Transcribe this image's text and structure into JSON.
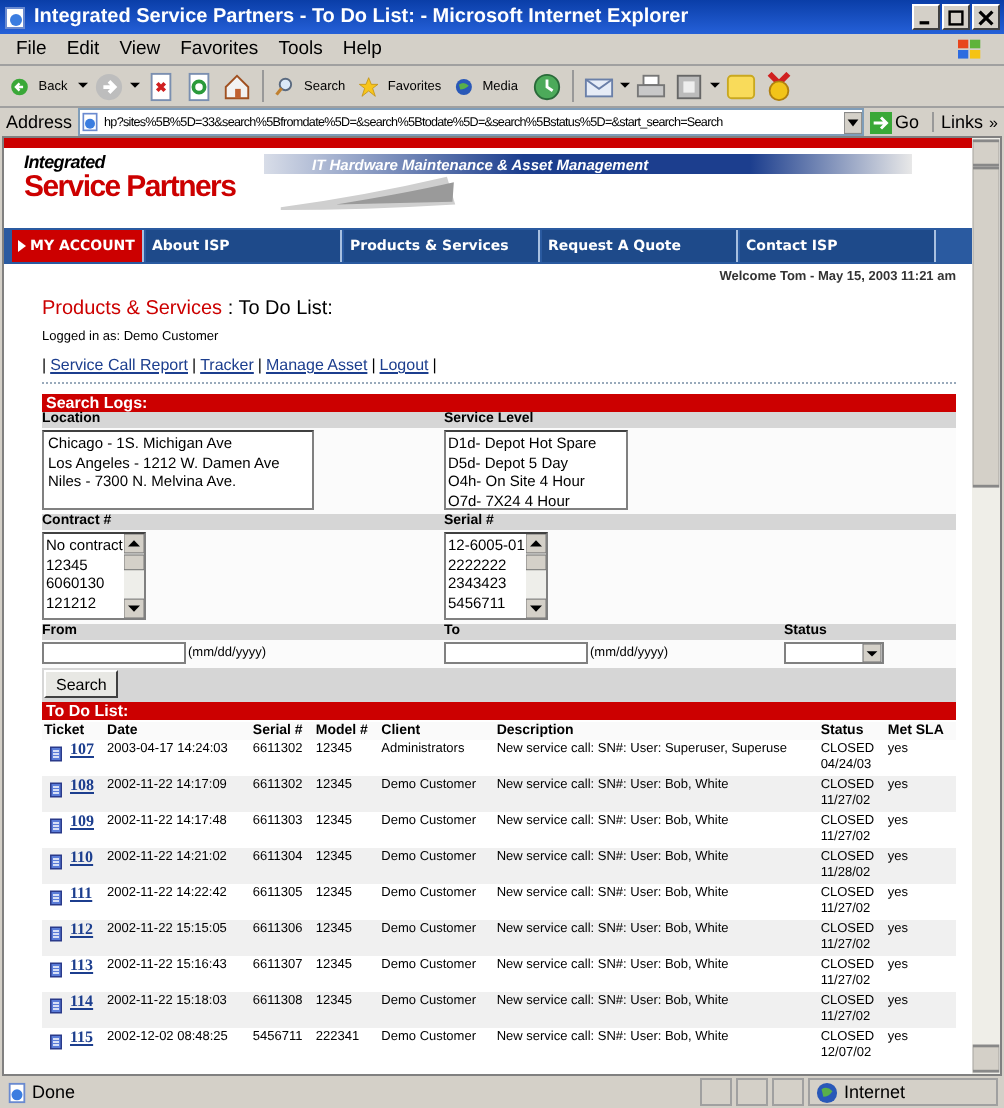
{
  "window": {
    "title": "Integrated Service Partners - To Do List: - Microsoft Internet Explorer"
  },
  "menu": [
    "File",
    "Edit",
    "View",
    "Favorites",
    "Tools",
    "Help"
  ],
  "toolbar": [
    {
      "kind": "back",
      "label": "Back"
    },
    {
      "kind": "forward"
    },
    {
      "kind": "stop"
    },
    {
      "kind": "refresh"
    },
    {
      "kind": "home"
    },
    {
      "kind": "search",
      "label": "Search"
    },
    {
      "kind": "favorites",
      "label": "Favorites"
    },
    {
      "kind": "media",
      "label": "Media"
    },
    {
      "kind": "history"
    },
    {
      "kind": "mail"
    },
    {
      "kind": "print"
    },
    {
      "kind": "edit"
    },
    {
      "kind": "notes"
    },
    {
      "kind": "messenger"
    }
  ],
  "address": {
    "label": "Address",
    "value": "hp?sites%5B%5D=33&search%5Bfromdate%5D=&search%5Btodate%5D=&search%5Bstatus%5D=&start_search=Search",
    "go": "Go",
    "links": "Links",
    "more": "»"
  },
  "banner": {
    "logo_top": "Integrated",
    "logo_bottom": "Service Partners",
    "tagline": "IT Hardware Maintenance & Asset Management"
  },
  "nav": [
    {
      "label": "MY ACCOUNT",
      "selected": true
    },
    {
      "label": "About ISP",
      "selected": false
    },
    {
      "label": "Products & Services",
      "selected": false
    },
    {
      "label": "Request A Quote",
      "selected": false
    },
    {
      "label": "Contact ISP",
      "selected": false
    }
  ],
  "welcome": "Welcome Tom - May 15, 2003 11:21 am",
  "heading": {
    "section": "Products & Services",
    "page": ": To Do List:"
  },
  "logged_in": "Logged in as: Demo Customer",
  "links": {
    "separator": "|",
    "items": [
      "Service Call Report",
      "Tracker",
      "Manage Asset",
      "Logout"
    ]
  },
  "search": {
    "title": "Search Logs:",
    "location": {
      "label": "Location",
      "options": [
        "Chicago - 1S. Michigan Ave",
        "Los Angeles - 1212 W. Damen Ave",
        "Niles - 7300 N. Melvina Ave."
      ]
    },
    "service_level": {
      "label": "Service Level",
      "options": [
        "D1d- Depot Hot Spare",
        "D5d- Depot 5 Day",
        "O4h- On Site 4 Hour",
        "O7d- 7X24 4 Hour"
      ]
    },
    "contract": {
      "label": "Contract #",
      "options": [
        "No contract",
        "12345",
        "6060130",
        "121212"
      ]
    },
    "serial": {
      "label": "Serial #",
      "options": [
        "12-6005-01",
        "2222222",
        "2343423",
        "5456711"
      ]
    },
    "from": {
      "label": "From",
      "hint": "(mm/dd/yyyy)"
    },
    "to": {
      "label": "To",
      "hint": "(mm/dd/yyyy)"
    },
    "status": {
      "label": "Status"
    },
    "button": "Search"
  },
  "todo": {
    "title": "To Do List:",
    "columns": [
      "Ticket",
      "Date",
      "Serial #",
      "Model #",
      "Client",
      "Description",
      "Status",
      "Met SLA"
    ],
    "rows": [
      {
        "ticket": "107",
        "date": "2003-04-17 14:24:03",
        "serial": "6611302",
        "model": "12345",
        "client": "Administrators",
        "description": "New service call: SN#: User: Superuser, Superuse",
        "status": "CLOSED",
        "status_date": "04/24/03",
        "met_sla": "yes"
      },
      {
        "ticket": "108",
        "date": "2002-11-22 14:17:09",
        "serial": "6611302",
        "model": "12345",
        "client": "Demo Customer",
        "description": "New service call: SN#: User: Bob, White",
        "status": "CLOSED",
        "status_date": "11/27/02",
        "met_sla": "yes"
      },
      {
        "ticket": "109",
        "date": "2002-11-22 14:17:48",
        "serial": "6611303",
        "model": "12345",
        "client": "Demo Customer",
        "description": "New service call: SN#: User: Bob, White",
        "status": "CLOSED",
        "status_date": "11/27/02",
        "met_sla": "yes"
      },
      {
        "ticket": "110",
        "date": "2002-11-22 14:21:02",
        "serial": "6611304",
        "model": "12345",
        "client": "Demo Customer",
        "description": "New service call: SN#: User: Bob, White",
        "status": "CLOSED",
        "status_date": "11/28/02",
        "met_sla": "yes"
      },
      {
        "ticket": "111",
        "date": "2002-11-22 14:22:42",
        "serial": "6611305",
        "model": "12345",
        "client": "Demo Customer",
        "description": "New service call: SN#: User: Bob, White",
        "status": "CLOSED",
        "status_date": "11/27/02",
        "met_sla": "yes"
      },
      {
        "ticket": "112",
        "date": "2002-11-22 15:15:05",
        "serial": "6611306",
        "model": "12345",
        "client": "Demo Customer",
        "description": "New service call: SN#: User: Bob, White",
        "status": "CLOSED",
        "status_date": "11/27/02",
        "met_sla": "yes"
      },
      {
        "ticket": "113",
        "date": "2002-11-22 15:16:43",
        "serial": "6611307",
        "model": "12345",
        "client": "Demo Customer",
        "description": "New service call: SN#: User: Bob, White",
        "status": "CLOSED",
        "status_date": "11/27/02",
        "met_sla": "yes"
      },
      {
        "ticket": "114",
        "date": "2002-11-22 15:18:03",
        "serial": "6611308",
        "model": "12345",
        "client": "Demo Customer",
        "description": "New service call: SN#: User: Bob, White",
        "status": "CLOSED",
        "status_date": "11/27/02",
        "met_sla": "yes"
      },
      {
        "ticket": "115",
        "date": "2002-12-02 08:48:25",
        "serial": "5456711",
        "model": "222341",
        "client": "Demo Customer",
        "description": "New service call: SN#: User: Bob, White",
        "status": "CLOSED",
        "status_date": "12/07/02",
        "met_sla": "yes"
      }
    ]
  },
  "status_bar": {
    "text": "Done",
    "zone": "Internet"
  }
}
